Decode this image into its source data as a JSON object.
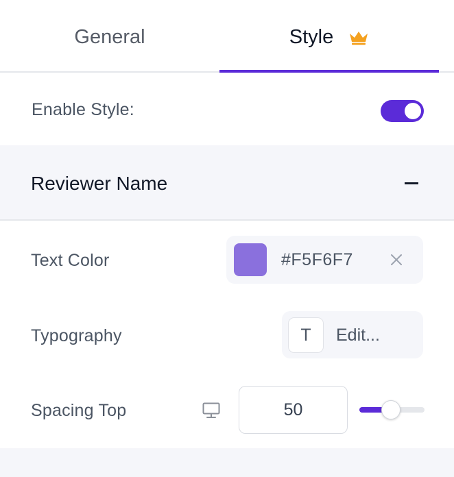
{
  "tabs": [
    {
      "label": "General",
      "active": false
    },
    {
      "label": "Style",
      "active": true,
      "badge_icon": "crown-icon"
    }
  ],
  "colors": {
    "accent": "#5b2bd8",
    "crown": "#f4a11f",
    "swatch": "#8a70dd",
    "panel_bg": "#f5f6fa"
  },
  "enable_style": {
    "label": "Enable Style:",
    "enabled": true
  },
  "section": {
    "title": "Reviewer Name",
    "collapse_icon": "minus-icon",
    "expanded": true
  },
  "text_color": {
    "label": "Text Color",
    "value": "#F5F6F7",
    "clear_icon": "close-icon"
  },
  "typography": {
    "label": "Typography",
    "badge": "T",
    "edit_label": "Edit..."
  },
  "spacing_top": {
    "label": "Spacing Top",
    "device_icon": "desktop-icon",
    "value": "50",
    "slider_fraction": 0.48
  }
}
